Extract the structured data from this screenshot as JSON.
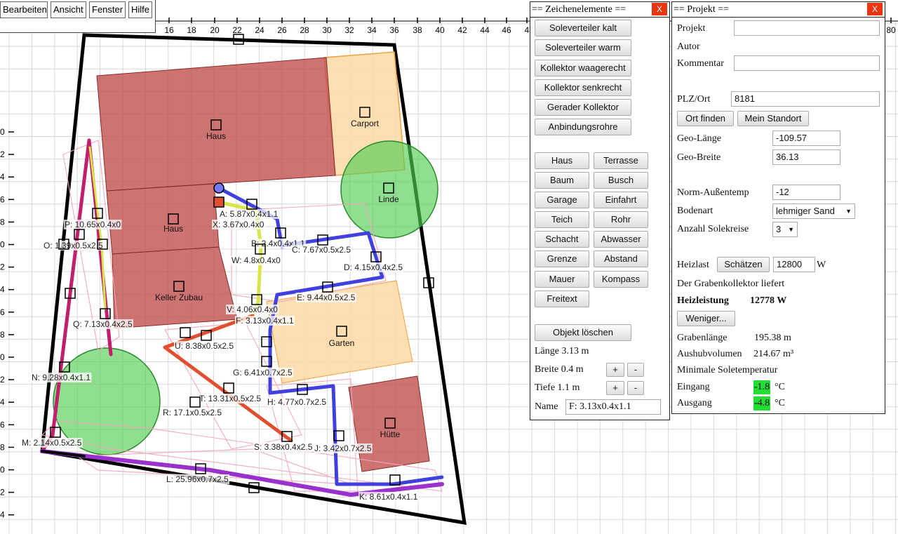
{
  "menu": {
    "items": [
      "Bearbeiten",
      "Ansicht",
      "Fenster",
      "Hilfe"
    ]
  },
  "ruler": {
    "top_ticks": [
      "16",
      "18",
      "20",
      "22",
      "24",
      "26",
      "28",
      "30",
      "32",
      "34",
      "36",
      "38",
      "40",
      "42",
      "44",
      "46",
      "4",
      "80"
    ],
    "left_ticks": [
      "0",
      "2",
      "4",
      "6",
      "8",
      "0",
      "2",
      "4",
      "6",
      "8",
      "0",
      "2",
      "4",
      "6",
      "8",
      "0",
      "2",
      "4"
    ]
  },
  "plan": {
    "objects": [
      {
        "name": "Haus",
        "kind": "house"
      },
      {
        "name": "Carport",
        "kind": "zone"
      },
      {
        "name": "Haus",
        "kind": "house"
      },
      {
        "name": "Keller Zubau",
        "kind": "house"
      },
      {
        "name": "Linde",
        "kind": "tree"
      },
      {
        "name": "Garten",
        "kind": "zone"
      },
      {
        "name": "Hütte",
        "kind": "house"
      }
    ],
    "collector_labels": [
      "A: 5.87x0.4x1.1",
      "X: 3.67x0.4x0",
      "B: 2.4x0.4x1.1",
      "C: 7.67x0.5x2.5",
      "D: 4.15x0.4x2.5",
      "W: 4.8x0.4x0",
      "E: 9.44x0.5x2.5",
      "V: 4.06x0.4x0",
      "F: 3.13x0.4x1.1",
      "P: 10.65x0.4x0",
      "O: 1.39x0.5x2.5",
      "Q: 7.13x0.4x2.5",
      "U: 8.38x0.5x2.5",
      "G: 6.41x0.7x2.5",
      "N: 9.28x0.4x1.1",
      "T: 13.31x0.5x2.5",
      "H: 4.77x0.7x2.5",
      "R: 17.1x0.5x2.5",
      "M: 2.14x0.5x2.5",
      "S: 3.38x0.4x2.5",
      "J: 3.42x0.7x2.5",
      "L: 25.96x0.7x2.5",
      "K: 8.61x0.4x1.1"
    ],
    "colors": {
      "house": "#c0504d",
      "zone": "#fdd9a5",
      "tree": "#55cc55",
      "border": "#000000",
      "pipe_pink": "#f4a6b8",
      "pipe_blue": "#4040e0",
      "pipe_red": "#e05030",
      "pipe_yellow": "#d9e64a",
      "pipe_purple": "#9932cc"
    }
  },
  "elements_panel": {
    "title": "== Zeichenelemente ==",
    "close": "X",
    "tools": [
      "Soleverteiler kalt",
      "Soleverteiler warm",
      "Kollektor waagerecht",
      "Kollektor senkrecht",
      "Gerader Kollektor",
      "Anbindungsrohre"
    ],
    "objects": [
      [
        "Haus",
        "Terrasse"
      ],
      [
        "Baum",
        "Busch"
      ],
      [
        "Garage",
        "Einfahrt"
      ],
      [
        "Teich",
        "Rohr"
      ],
      [
        "Schacht",
        "Abwasser"
      ],
      [
        "Grenze",
        "Abstand"
      ],
      [
        "Mauer",
        "Kompass"
      ],
      [
        "Freitext"
      ]
    ],
    "delete_label": "Objekt löschen",
    "length_label": "Länge 3.13 m",
    "width_label": "Breite 0.4 m",
    "depth_label": "Tiefe  1.1 m",
    "plus": "+",
    "minus": "-",
    "name_label": "Name",
    "name_value": "F: 3.13x0.4x1.1"
  },
  "project_panel": {
    "title": "== Projekt ==",
    "close": "X",
    "projekt_label": "Projekt",
    "projekt_value": "",
    "autor_label": "Autor",
    "kommentar_label": "Kommentar",
    "kommentar_value": "",
    "plz_label": "PLZ/Ort",
    "plz_value": "8181",
    "ort_finden": "Ort finden",
    "mein_standort": "Mein Standort",
    "geo_laenge_label": "Geo-Länge",
    "geo_laenge_value": "-109.57",
    "geo_breite_label": "Geo-Breite",
    "geo_breite_value": "36.13",
    "norm_label": "Norm-Außentemp",
    "norm_value": "-12",
    "bodenart_label": "Bodenart",
    "bodenart_value": "lehmiger Sand",
    "solekreise_label": "Anzahl Solekreise",
    "solekreise_value": "3",
    "heizlast_label": "Heizlast",
    "schaetzen": "Schätzen",
    "heizlast_value": "12800",
    "heizlast_unit": "W",
    "liefert_text": "Der Grabenkollektor liefert",
    "heizleistung_label": "Heizleistung",
    "heizleistung_value": "12778 W",
    "weniger": "Weniger...",
    "grabenlaenge_label": "Grabenlänge",
    "grabenlaenge_value": "195.38 m",
    "aushub_label": "Aushubvolumen",
    "aushub_value": "214.67 m³",
    "min_sole_label": "Minimale Soletemperatur",
    "eingang_label": "Eingang",
    "eingang_value": "-1.8",
    "ausgang_label": "Ausgang",
    "ausgang_value": "-4.8",
    "temp_unit": "°C"
  }
}
